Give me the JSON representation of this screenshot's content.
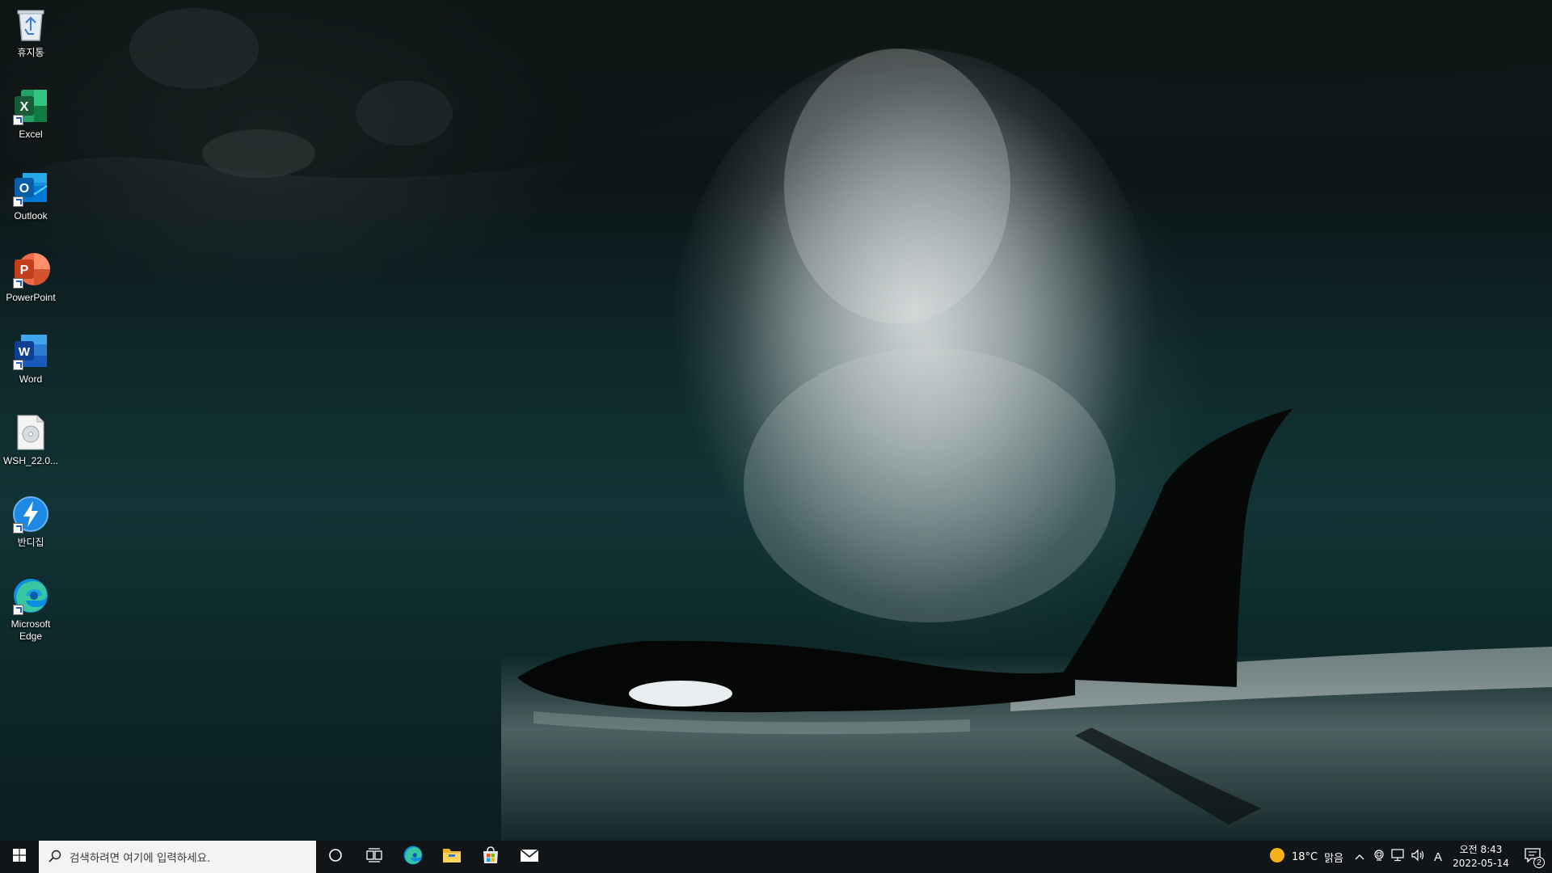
{
  "desktop": {
    "icons": [
      {
        "id": "recycle-bin",
        "label": "휴지통",
        "icon": "recycle-bin-icon"
      },
      {
        "id": "excel",
        "label": "Excel",
        "icon": "excel-icon",
        "shortcut": true
      },
      {
        "id": "outlook",
        "label": "Outlook",
        "icon": "outlook-icon",
        "shortcut": true
      },
      {
        "id": "powerpoint",
        "label": "PowerPoint",
        "icon": "powerpoint-icon",
        "shortcut": true
      },
      {
        "id": "word",
        "label": "Word",
        "icon": "word-icon",
        "shortcut": true
      },
      {
        "id": "wsh-file",
        "label": "WSH_22.0...",
        "icon": "disc-image-file-icon"
      },
      {
        "id": "bandizip",
        "label": "반디집",
        "icon": "bandizip-icon",
        "shortcut": true
      },
      {
        "id": "edge",
        "label": "Microsoft Edge",
        "icon": "edge-icon",
        "shortcut": true
      }
    ]
  },
  "taskbar": {
    "search_placeholder": "검색하려면 여기에 입력하세요.",
    "pinned_apps": [
      "cortana-icon",
      "task-view-icon",
      "edge-icon",
      "file-explorer-icon",
      "microsoft-store-icon",
      "mail-icon"
    ],
    "weather": {
      "temperature": "18°C",
      "condition": "맑음",
      "icon": "sun-icon"
    },
    "ime_indicator": "A",
    "clock": {
      "time": "오전 8:43",
      "date": "2022-05-14"
    },
    "notification_count": "2"
  },
  "colors": {
    "taskbar_bg": "#111518",
    "search_bg": "#f3f3f3",
    "excel": "#1d6f42",
    "outlook": "#0f6cbd",
    "powerpoint": "#c43e1c",
    "word": "#185abd",
    "edge": "#0c8de0"
  }
}
